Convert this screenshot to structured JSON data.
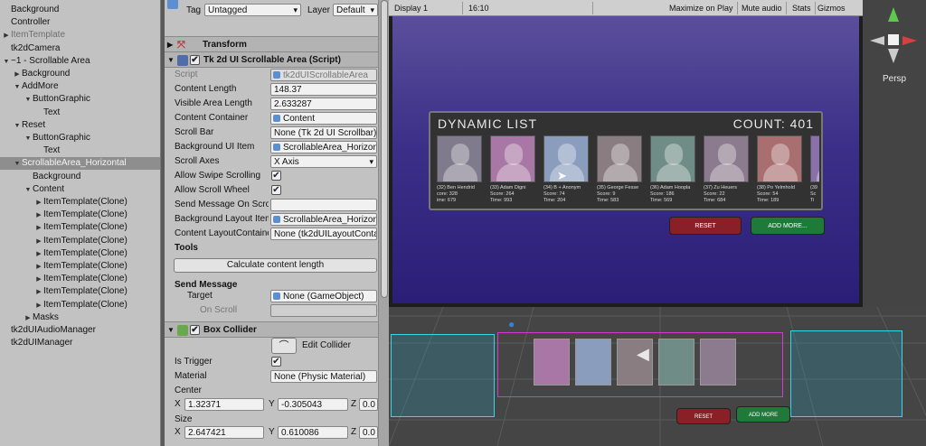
{
  "hierarchy": {
    "rows": [
      {
        "label": "Background",
        "indent": 0,
        "arrow": ""
      },
      {
        "label": "Controller",
        "indent": 0,
        "arrow": ""
      },
      {
        "label": "ItemTemplate",
        "indent": 0,
        "arrow": "▶",
        "prefab": true
      },
      {
        "label": "tk2dCamera",
        "indent": 0,
        "arrow": ""
      },
      {
        "label": "~1 - Scrollable Area",
        "indent": 0,
        "arrow": "▼"
      },
      {
        "label": "Background",
        "indent": 1,
        "arrow": "▶"
      },
      {
        "label": "AddMore",
        "indent": 1,
        "arrow": "▼"
      },
      {
        "label": "ButtonGraphic",
        "indent": 2,
        "arrow": "▼"
      },
      {
        "label": "Text",
        "indent": 3,
        "arrow": ""
      },
      {
        "label": "Reset",
        "indent": 1,
        "arrow": "▼"
      },
      {
        "label": "ButtonGraphic",
        "indent": 2,
        "arrow": "▼"
      },
      {
        "label": "Text",
        "indent": 3,
        "arrow": ""
      },
      {
        "label": "ScrollableArea_Horizontal",
        "indent": 1,
        "arrow": "▼",
        "selected": true
      },
      {
        "label": "Background",
        "indent": 2,
        "arrow": ""
      },
      {
        "label": "Content",
        "indent": 2,
        "arrow": "▼"
      },
      {
        "label": "ItemTemplate(Clone)",
        "indent": 3,
        "arrow": "▶"
      },
      {
        "label": "ItemTemplate(Clone)",
        "indent": 3,
        "arrow": "▶"
      },
      {
        "label": "ItemTemplate(Clone)",
        "indent": 3,
        "arrow": "▶"
      },
      {
        "label": "ItemTemplate(Clone)",
        "indent": 3,
        "arrow": "▶"
      },
      {
        "label": "ItemTemplate(Clone)",
        "indent": 3,
        "arrow": "▶"
      },
      {
        "label": "ItemTemplate(Clone)",
        "indent": 3,
        "arrow": "▶"
      },
      {
        "label": "ItemTemplate(Clone)",
        "indent": 3,
        "arrow": "▶"
      },
      {
        "label": "ItemTemplate(Clone)",
        "indent": 3,
        "arrow": "▶"
      },
      {
        "label": "ItemTemplate(Clone)",
        "indent": 3,
        "arrow": "▶"
      },
      {
        "label": "Masks",
        "indent": 2,
        "arrow": "▶"
      },
      {
        "label": "tk2dUIAudioManager",
        "indent": 0,
        "arrow": ""
      },
      {
        "label": "tk2dUIManager",
        "indent": 0,
        "arrow": ""
      }
    ]
  },
  "inspector": {
    "tag_label": "Tag",
    "tag_value": "Untagged",
    "layer_label": "Layer",
    "layer_value": "Default",
    "transform_label": "Transform",
    "script_title": "Tk 2d UI Scrollable Area (Script)",
    "fields": [
      {
        "label": "Script",
        "value": "tk2dUIScrollableArea",
        "kind": "obj",
        "dim": true
      },
      {
        "label": "Content Length",
        "value": "148.37",
        "kind": "text"
      },
      {
        "label": "Visible Area Length",
        "value": "2.633287",
        "kind": "text"
      },
      {
        "label": "Content Container",
        "value": "Content",
        "kind": "obj"
      },
      {
        "label": "Scroll Bar",
        "value": "None (Tk 2d UI Scrollbar)",
        "kind": "text"
      },
      {
        "label": "Background UI Item",
        "value": "ScrollableArea_Horizontal",
        "kind": "obj"
      },
      {
        "label": "Scroll Axes",
        "value": "X Axis",
        "kind": "dd"
      },
      {
        "label": "Allow Swipe Scrolling",
        "value": "",
        "kind": "check"
      },
      {
        "label": "Allow Scroll Wheel",
        "value": "",
        "kind": "check"
      },
      {
        "label": "Send Message On Scroll",
        "value": "",
        "kind": "text"
      },
      {
        "label": "Background Layout Item",
        "value": "ScrollableArea_Horizontal",
        "kind": "obj"
      },
      {
        "label": "Content LayoutContainer",
        "value": "None (tk2dUILayoutContainer)",
        "kind": "text"
      }
    ],
    "tools_label": "Tools",
    "calc_button": "Calculate content length",
    "send_message_label": "Send Message",
    "target_label": "Target",
    "target_value": "None (GameObject)",
    "on_scroll_label": "On Scroll",
    "box_collider_title": "Box Collider",
    "edit_collider": "Edit Collider",
    "is_trigger": "Is Trigger",
    "material_label": "Material",
    "material_value": "None (Physic Material)",
    "center_label": "Center",
    "center": {
      "x": "1.32371",
      "y": "-0.305043",
      "z": "0.0"
    },
    "size_label": "Size",
    "size": {
      "x": "2.647421",
      "y": "0.610086",
      "z": "0.0"
    }
  },
  "game": {
    "display": "Display 1",
    "aspect": "16:10",
    "maximize": "Maximize on Play",
    "mute": "Mute audio",
    "stats": "Stats",
    "gizmos": "Gizmos",
    "list_title": "DYNAMIC LIST",
    "count": "COUNT: 401",
    "cards": [
      {
        "name": "(32) Ben Hendrid",
        "score": "core: 328",
        "time": "ime: 679",
        "color": "#7f7a8c"
      },
      {
        "name": "(33) Adam Digni",
        "score": "Score: 264",
        "time": "Time: 993",
        "color": "#a977a5"
      },
      {
        "name": "(34) B + Anonym",
        "score": "Score: 74",
        "time": "Time: 204",
        "color": "#8a9dbd"
      },
      {
        "name": "(35) George Fesse",
        "score": "Score: 9",
        "time": "Time: 583",
        "color": "#8a7d82"
      },
      {
        "name": "(36) Adam Hoopla",
        "score": "Score: 186",
        "time": "Time: 569",
        "color": "#6f8c86"
      },
      {
        "name": "(37) Zu Heuers",
        "score": "Score: 22",
        "time": "Time: 684",
        "color": "#8c7a8e"
      },
      {
        "name": "(38) Po Yelmhold",
        "score": "Score: 54",
        "time": "Time: 189",
        "color": "#a96e70"
      },
      {
        "name": "(39",
        "score": "Sc",
        "time": "Ti",
        "color": "#8a6fa8"
      }
    ],
    "reset": "RESET",
    "add_more": "ADD MORE..."
  },
  "scene": {
    "persp": "Persp",
    "reset": "RESET",
    "add_more": "ADD MORE"
  },
  "colors": {
    "reset": "#8a1f27",
    "add": "#1f7a3a",
    "selection": "#8e8e8e"
  }
}
